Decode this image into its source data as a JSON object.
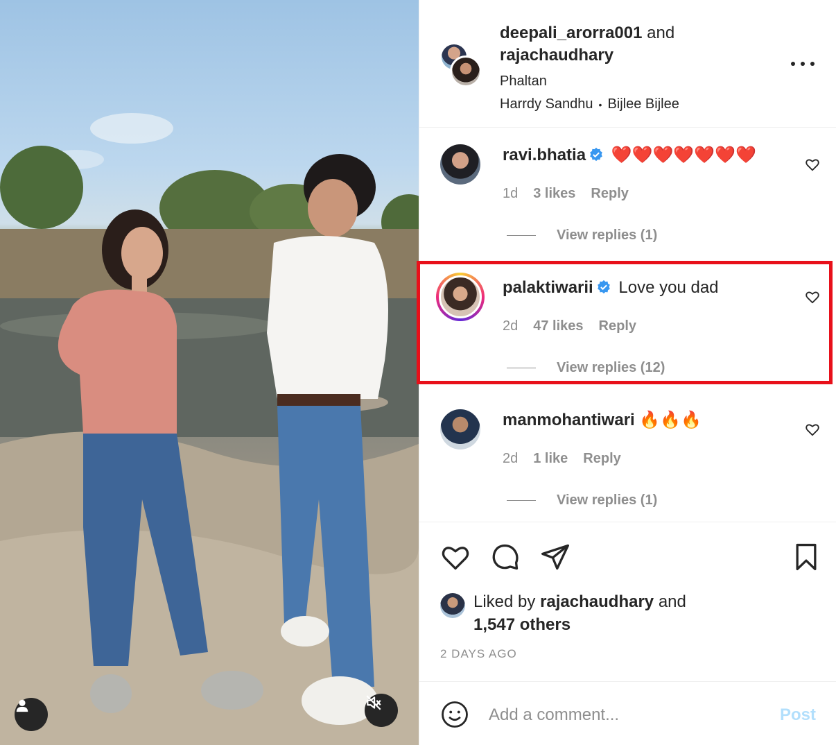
{
  "post": {
    "owner1": "deepali_arorra001",
    "connector": "and",
    "owner2": "rajachaudhary",
    "location": "Phaltan",
    "audio_artist": "Harrdy Sandhu",
    "audio_separator": "•",
    "audio_track": "Bijlee Bijlee",
    "more_icon": "more-horizontal-icon"
  },
  "comments": [
    {
      "username": "ravi.bhatia",
      "verified": true,
      "text": "❤️❤️❤️❤️❤️❤️❤️",
      "time": "1d",
      "likes": "3 likes",
      "reply": "Reply",
      "view_replies": "View replies (1)"
    },
    {
      "username": "palaktiwarii",
      "verified": true,
      "text": "Love you dad",
      "time": "2d",
      "likes": "47 likes",
      "reply": "Reply",
      "view_replies": "View replies (12)",
      "highlighted": true
    },
    {
      "username": "manmohantiwari",
      "verified": false,
      "text": "🔥🔥🔥",
      "time": "2d",
      "likes": "1 like",
      "reply": "Reply",
      "view_replies": "View replies (1)"
    }
  ],
  "engagement": {
    "liked_by_prefix": "Liked by",
    "liked_by_user": "rajachaudhary",
    "liked_by_and": "and",
    "liked_by_others": "1,547 others",
    "timestamp": "2 DAYS AGO"
  },
  "add_comment": {
    "placeholder": "Add a comment...",
    "post_label": "Post"
  },
  "colors": {
    "highlight": "#e8101a",
    "verified": "#3897f0",
    "post_disabled": "#b2dffc",
    "muted_text": "#8e8e8e"
  }
}
